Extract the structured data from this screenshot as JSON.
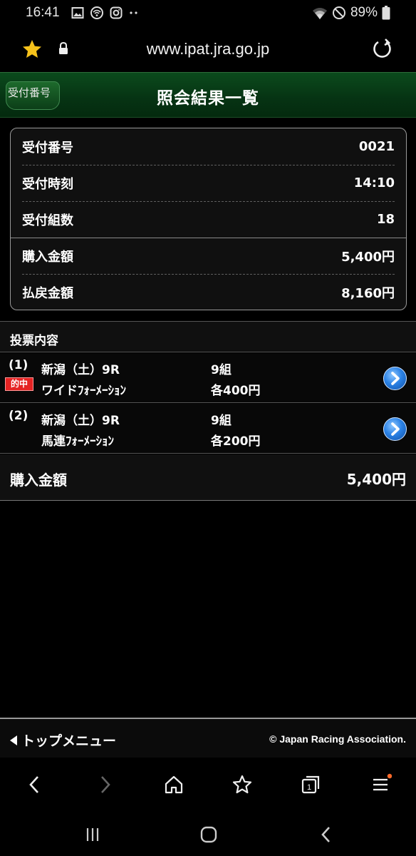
{
  "status": {
    "time": "16:41",
    "battery": "89%"
  },
  "browser": {
    "url": "www.ipat.jra.go.jp"
  },
  "header": {
    "back_label": "受付番号",
    "title": "照会結果一覧"
  },
  "receipt": [
    {
      "label": "受付番号",
      "value": "0021"
    },
    {
      "label": "受付時刻",
      "value": "14:10"
    },
    {
      "label": "受付組数",
      "value": "18"
    },
    {
      "label": "購入金額",
      "value": "5,400円"
    },
    {
      "label": "払戻金額",
      "value": "8,160円"
    }
  ],
  "section_title": "投票内容",
  "bets": [
    {
      "num": "(1)",
      "hit": "的中",
      "race": "新潟（土）9R",
      "type": "ワイドﾌｫｰﾒｰｼｮﾝ",
      "count": "9組",
      "each": "各400円"
    },
    {
      "num": "(2)",
      "hit": "",
      "race": "新潟（土）9R",
      "type": "馬連ﾌｫｰﾒｰｼｮﾝ",
      "count": "9組",
      "each": "各200円"
    }
  ],
  "total": {
    "label": "購入金額",
    "value": "5,400円"
  },
  "footer": {
    "menu_label": "トップメニュー",
    "copyright": "© Japan Racing Association."
  },
  "colors": {
    "header_green": "#063313",
    "hit_red": "#e52323",
    "arrow_blue": "#2b82e6",
    "star_yellow": "#f6c21b"
  }
}
